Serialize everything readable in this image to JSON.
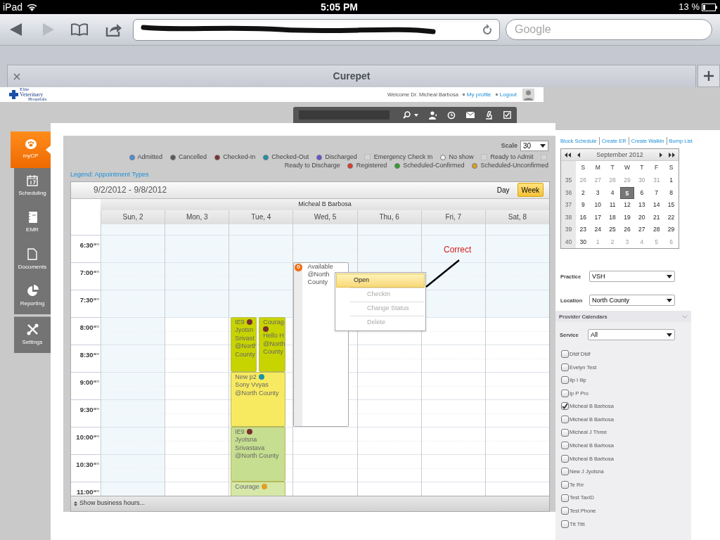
{
  "status_bar": {
    "device": "iPad",
    "time": "5:05 PM",
    "battery": "13 %"
  },
  "browser": {
    "search_placeholder": "Google",
    "tab_title": "Curepet"
  },
  "header": {
    "logo": [
      "Elite",
      "Veterinary",
      "Hospitals"
    ],
    "welcome": "Welcome Dr. Micheal Barbosa",
    "links": [
      "My profile",
      "Logout"
    ]
  },
  "nav": [
    {
      "label": "myCP",
      "selected": true
    },
    {
      "label": "Scheduling",
      "selected": false
    },
    {
      "label": "EMR",
      "selected": false
    },
    {
      "label": "Documents",
      "selected": false
    },
    {
      "label": "Reporting",
      "selected": false
    },
    {
      "label": "Settings",
      "selected": false
    }
  ],
  "scale": {
    "label": "Scale",
    "value": "30"
  },
  "legend": [
    {
      "kind": "dot",
      "label": "Admitted",
      "color": "#4a8fe0"
    },
    {
      "kind": "dot",
      "label": "Cancelled",
      "color": "#5a5a5a"
    },
    {
      "kind": "dot",
      "label": "Checked-In",
      "color": "#7b2f2f"
    },
    {
      "kind": "dot",
      "label": "Checked-Out",
      "color": "#1b93a6"
    },
    {
      "kind": "dot",
      "label": "Discharged",
      "color": "#6a4fd8"
    },
    {
      "kind": "box",
      "label": "Emergency Check In"
    },
    {
      "kind": "dot",
      "label": "No show",
      "color": "#f2f2f2"
    },
    {
      "kind": "box",
      "label": "Ready to Admit"
    },
    {
      "kind": "box",
      "label": "Ready to Discharge"
    },
    {
      "kind": "dot",
      "label": "Registered",
      "color": "#e0392b"
    },
    {
      "kind": "dot",
      "label": "Scheduled-Confirmed",
      "color": "#2ea02e"
    },
    {
      "kind": "dot",
      "label": "Scheduled-Unconfirmed",
      "color": "#e0a020"
    }
  ],
  "legend_link": "Legend: Appointment Types",
  "range": "9/2/2012 - 9/8/2012",
  "views": [
    {
      "label": "Day",
      "selected": false
    },
    {
      "label": "Week",
      "selected": true
    }
  ],
  "provider": "Micheal B Barbosa",
  "times": [
    "6:30$^{am}$",
    "7:00$^{am}$",
    "7:30$^{am}$",
    "8:00$^{am}$",
    "8:30$^{am}$",
    "9:00$^{am}$",
    "9:30$^{am}$",
    "10:00$^{am}$",
    "10:30$^{am}$",
    "11:00$^{am}$"
  ],
  "days": [
    {
      "label": "Sun, 2",
      "weekend": true
    },
    {
      "label": "Mon, 3",
      "weekend": false
    },
    {
      "label": "Tue, 4",
      "weekend": false,
      "events": [
        {
          "kind": "appointment",
          "color": "#c8d400",
          "status": {
            "color": "#7b2f2f"
          },
          "lines": [
            "IE9",
            "Jyotsn",
            "Srivast",
            "@North",
            "County"
          ]
        },
        {
          "kind": "appointment",
          "color": "#c8d400",
          "status": {
            "color": "#7b2f2f"
          },
          "lines": [
            "Courag",
            "Hello H",
            "@North",
            "County"
          ]
        },
        {
          "kind": "appointment",
          "color": "#f8ea60",
          "status": {
            "color": "#1b93a6"
          },
          "lines": [
            "New p2",
            "Sony Vvyas",
            "@North County"
          ]
        },
        {
          "kind": "appointment",
          "color": "#c6de90",
          "status": {
            "color": "#7b2f2f"
          },
          "lines": [
            "IE9",
            "Jyotsna",
            "Srivastava",
            "@North County"
          ]
        },
        {
          "kind": "appointment",
          "color": "#d6e8a8",
          "status": {
            "color": "#e0a020"
          },
          "lines": [
            "Courage"
          ]
        }
      ]
    },
    {
      "label": "Wed, 5",
      "weekend": false,
      "events": [
        {
          "kind": "available",
          "color": "#ffffff",
          "badge": "0",
          "lines": [
            "Available",
            "@North",
            "County"
          ]
        }
      ]
    },
    {
      "label": "Thu, 6",
      "weekend": false
    },
    {
      "label": "Fri, 7",
      "weekend": false
    },
    {
      "label": "Sat, 8",
      "weekend": false
    }
  ],
  "context_menu": [
    {
      "label": "Open",
      "selected": true,
      "disabled": false
    },
    {
      "label": "CheckIn",
      "selected": false,
      "disabled": true
    },
    {
      "label": "Change Status",
      "selected": false,
      "disabled": true
    },
    {
      "label": "Delete",
      "selected": false,
      "disabled": true
    }
  ],
  "annotation": "Correct",
  "footer": "Show business hours...",
  "sidebar": {
    "links": [
      "Block Schedule",
      "Create ER",
      "Create Walkin",
      "Bump List"
    ],
    "calendar": {
      "month": "September 2012",
      "weekdays": [
        "S",
        "M",
        "T",
        "W",
        "T",
        "F",
        "S"
      ],
      "weeks": [
        {
          "number": "35",
          "days": [
            {
              "d": "26",
              "outside": true,
              "selected": false
            },
            {
              "d": "27",
              "outside": true,
              "selected": false
            },
            {
              "d": "28",
              "outside": true,
              "selected": false
            },
            {
              "d": "29",
              "outside": true,
              "selected": false
            },
            {
              "d": "30",
              "outside": true,
              "selected": false
            },
            {
              "d": "31",
              "outside": true,
              "selected": false
            },
            {
              "d": "1",
              "outside": false,
              "selected": false
            }
          ]
        },
        {
          "number": "36",
          "days": [
            {
              "d": "2",
              "outside": false,
              "selected": false
            },
            {
              "d": "3",
              "outside": false,
              "selected": false
            },
            {
              "d": "4",
              "outside": false,
              "selected": false
            },
            {
              "d": "5",
              "outside": false,
              "selected": true
            },
            {
              "d": "6",
              "outside": false,
              "selected": false
            },
            {
              "d": "7",
              "outside": false,
              "selected": false
            },
            {
              "d": "8",
              "outside": false,
              "selected": false
            }
          ]
        },
        {
          "number": "37",
          "days": [
            {
              "d": "9",
              "outside": false,
              "selected": false
            },
            {
              "d": "10",
              "outside": false,
              "selected": false
            },
            {
              "d": "11",
              "outside": false,
              "selected": false
            },
            {
              "d": "12",
              "outside": false,
              "selected": false
            },
            {
              "d": "13",
              "outside": false,
              "selected": false
            },
            {
              "d": "14",
              "outside": false,
              "selected": false
            },
            {
              "d": "15",
              "outside": false,
              "selected": false
            }
          ]
        },
        {
          "number": "38",
          "days": [
            {
              "d": "16",
              "outside": false,
              "selected": false
            },
            {
              "d": "17",
              "outside": false,
              "selected": false
            },
            {
              "d": "18",
              "outside": false,
              "selected": false
            },
            {
              "d": "19",
              "outside": false,
              "selected": false
            },
            {
              "d": "20",
              "outside": false,
              "selected": false
            },
            {
              "d": "21",
              "outside": false,
              "selected": false
            },
            {
              "d": "22",
              "outside": false,
              "selected": false
            }
          ]
        },
        {
          "number": "39",
          "days": [
            {
              "d": "23",
              "outside": false,
              "selected": false
            },
            {
              "d": "24",
              "outside": false,
              "selected": false
            },
            {
              "d": "25",
              "outside": false,
              "selected": false
            },
            {
              "d": "26",
              "outside": false,
              "selected": false
            },
            {
              "d": "27",
              "outside": false,
              "selected": false
            },
            {
              "d": "28",
              "outside": false,
              "selected": false
            },
            {
              "d": "29",
              "outside": false,
              "selected": false
            }
          ]
        },
        {
          "number": "40",
          "days": [
            {
              "d": "30",
              "outside": false,
              "selected": false
            },
            {
              "d": "1",
              "outside": true,
              "selected": false
            },
            {
              "d": "2",
              "outside": true,
              "selected": false
            },
            {
              "d": "3",
              "outside": true,
              "selected": false
            },
            {
              "d": "4",
              "outside": true,
              "selected": false
            },
            {
              "d": "5",
              "outside": true,
              "selected": false
            },
            {
              "d": "6",
              "outside": true,
              "selected": false
            }
          ]
        }
      ]
    },
    "practice": {
      "label": "Practice",
      "value": "VSH"
    },
    "location": {
      "label": "Location",
      "value": "North County"
    },
    "provider_calendars": {
      "title": "Provider Calendars",
      "service": {
        "label": "Service",
        "value": "All"
      },
      "providers": [
        {
          "name": "Dfdf Dfdf",
          "checked": false
        },
        {
          "name": "Evelyn Test",
          "checked": false
        },
        {
          "name": "Iip I Iiip",
          "checked": false
        },
        {
          "name": "Ip P Pro",
          "checked": false
        },
        {
          "name": "Micheal B Barbosa",
          "checked": true
        },
        {
          "name": "Micheal B Barbosa",
          "checked": false
        },
        {
          "name": "Micheal J Three",
          "checked": false
        },
        {
          "name": "Micheal B Barbosa",
          "checked": false
        },
        {
          "name": "Micheal B Barbosa",
          "checked": false
        },
        {
          "name": "New J Jyotsna",
          "checked": false
        },
        {
          "name": "Te Rrr",
          "checked": false
        },
        {
          "name": "Test TaxID",
          "checked": false
        },
        {
          "name": "Test Phone",
          "checked": false
        },
        {
          "name": "Ttt Tttt",
          "checked": false
        }
      ]
    }
  }
}
